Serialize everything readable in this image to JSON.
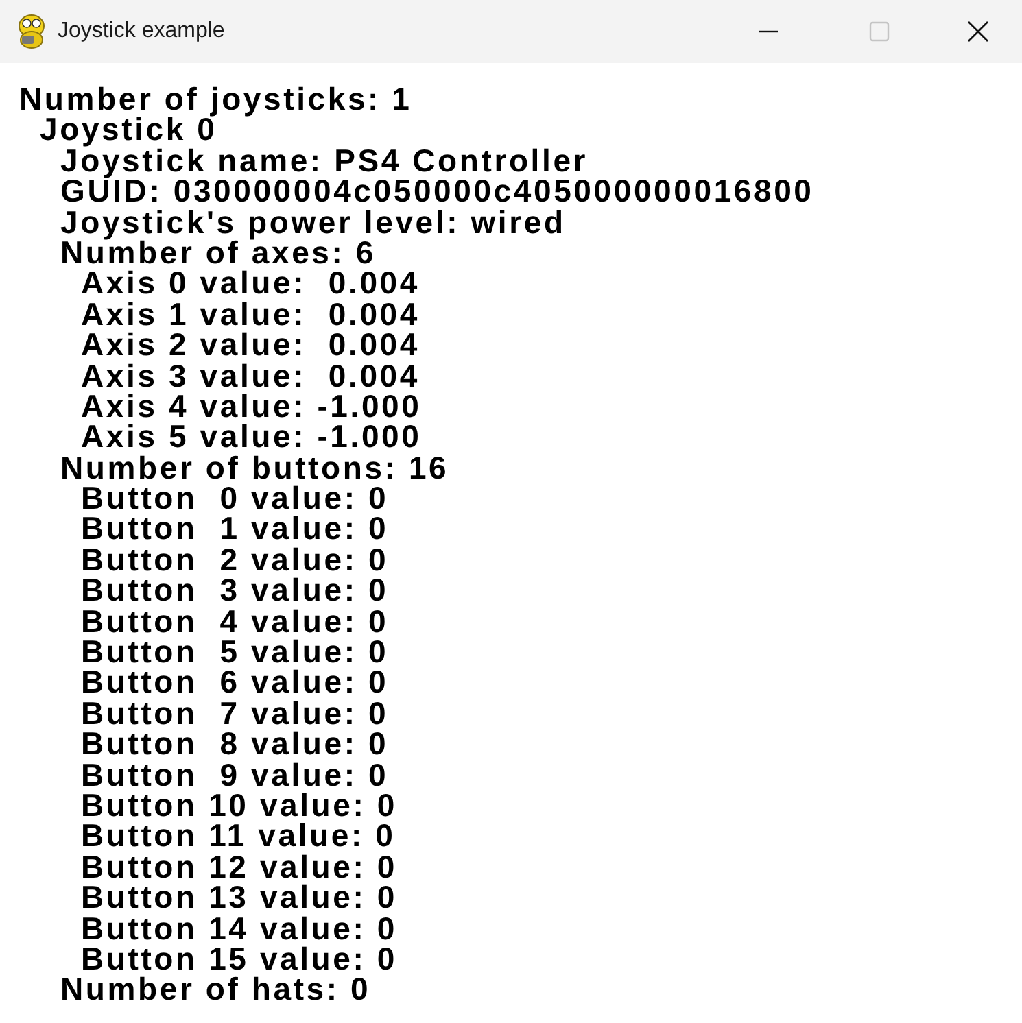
{
  "window": {
    "title": "Joystick example",
    "maximize_disabled": true
  },
  "lines": [
    {
      "text": "Number of joysticks: 1",
      "children": [
        {
          "text": "Joystick 0",
          "children": [
            {
              "text": "Joystick name: PS4 Controller"
            },
            {
              "text": "GUID: 030000004c050000c405000000016800"
            },
            {
              "text": "Joystick's power level: wired"
            },
            {
              "text": "Number of axes: 6",
              "children": [
                {
                  "text": "Axis 0 value:  0.004"
                },
                {
                  "text": "Axis 1 value:  0.004"
                },
                {
                  "text": "Axis 2 value:  0.004"
                },
                {
                  "text": "Axis 3 value:  0.004"
                },
                {
                  "text": "Axis 4 value: -1.000"
                },
                {
                  "text": "Axis 5 value: -1.000"
                }
              ]
            },
            {
              "text": "Number of buttons: 16",
              "children": [
                {
                  "text": "Button  0 value: 0"
                },
                {
                  "text": "Button  1 value: 0"
                },
                {
                  "text": "Button  2 value: 0"
                },
                {
                  "text": "Button  3 value: 0"
                },
                {
                  "text": "Button  4 value: 0"
                },
                {
                  "text": "Button  5 value: 0"
                },
                {
                  "text": "Button  6 value: 0"
                },
                {
                  "text": "Button  7 value: 0"
                },
                {
                  "text": "Button  8 value: 0"
                },
                {
                  "text": "Button  9 value: 0"
                },
                {
                  "text": "Button 10 value: 0"
                },
                {
                  "text": "Button 11 value: 0"
                },
                {
                  "text": "Button 12 value: 0"
                },
                {
                  "text": "Button 13 value: 0"
                },
                {
                  "text": "Button 14 value: 0"
                },
                {
                  "text": "Button 15 value: 0"
                }
              ]
            },
            {
              "text": "Number of hats: 0"
            }
          ]
        }
      ]
    }
  ]
}
